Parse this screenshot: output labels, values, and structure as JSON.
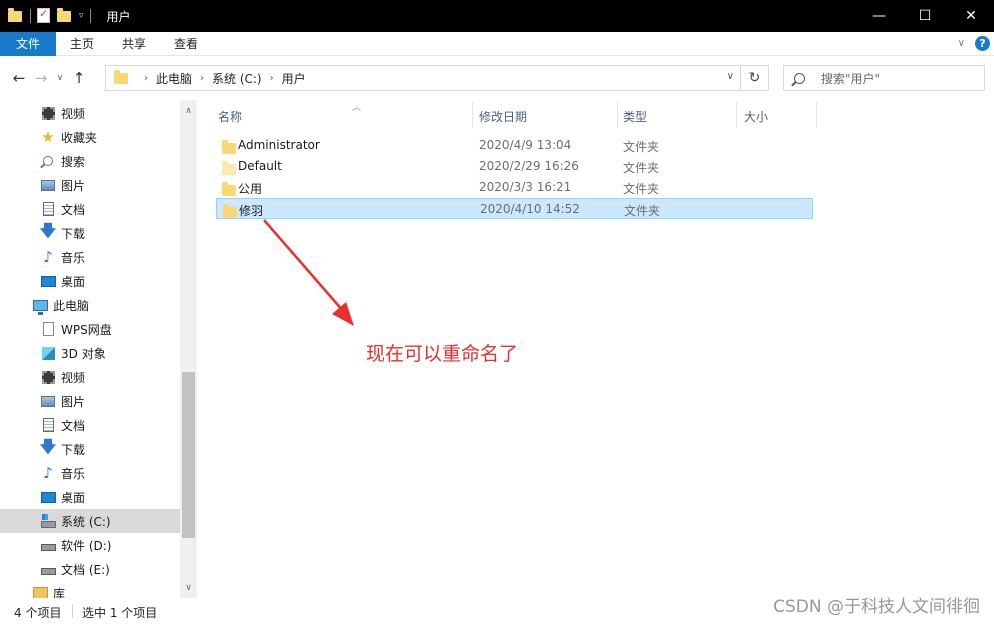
{
  "window": {
    "title": "用户",
    "minimize_icon": "minimize-icon",
    "maximize_icon": "maximize-icon",
    "close_icon": "close-icon"
  },
  "ribbon": {
    "file_tab": "文件",
    "tabs": [
      "主页",
      "共享",
      "查看"
    ]
  },
  "address": {
    "breadcrumbs": [
      "此电脑",
      "系统 (C:)",
      "用户"
    ],
    "search_placeholder": "搜索\"用户\""
  },
  "sidebar": {
    "items": [
      {
        "label": "视频",
        "icon": "video-icon"
      },
      {
        "label": "收藏夹",
        "icon": "star-icon"
      },
      {
        "label": "搜索",
        "icon": "search-icon"
      },
      {
        "label": "图片",
        "icon": "pictures-icon"
      },
      {
        "label": "文档",
        "icon": "documents-icon"
      },
      {
        "label": "下载",
        "icon": "download-icon"
      },
      {
        "label": "音乐",
        "icon": "music-icon"
      },
      {
        "label": "桌面",
        "icon": "desktop-icon"
      },
      {
        "label": "此电脑",
        "icon": "this-pc-icon"
      },
      {
        "label": "WPS网盘",
        "icon": "wps-drive-icon"
      },
      {
        "label": "3D 对象",
        "icon": "3d-objects-icon"
      },
      {
        "label": "视频",
        "icon": "video-icon"
      },
      {
        "label": "图片",
        "icon": "pictures-icon"
      },
      {
        "label": "文档",
        "icon": "documents-icon"
      },
      {
        "label": "下载",
        "icon": "download-icon"
      },
      {
        "label": "音乐",
        "icon": "music-icon"
      },
      {
        "label": "桌面",
        "icon": "desktop-icon"
      },
      {
        "label": "系统 (C:)",
        "icon": "system-drive-icon",
        "selected": true
      },
      {
        "label": "软件 (D:)",
        "icon": "drive-icon"
      },
      {
        "label": "文档 (E:)",
        "icon": "drive-icon"
      },
      {
        "label": "库",
        "icon": "library-icon"
      }
    ]
  },
  "columns": {
    "name": "名称",
    "modified": "修改日期",
    "type": "类型",
    "size": "大小"
  },
  "files": [
    {
      "name": "Administrator",
      "modified": "2020/4/9 13:04",
      "type": "文件夹"
    },
    {
      "name": "Default",
      "modified": "2020/2/29 16:26",
      "type": "文件夹"
    },
    {
      "name": "公用",
      "modified": "2020/3/3 16:21",
      "type": "文件夹"
    },
    {
      "name": "修羽",
      "modified": "2020/4/10 14:52",
      "type": "文件夹",
      "selected": true
    }
  ],
  "annotation": {
    "text": "现在可以重命名了",
    "color": "#e8302c"
  },
  "status": {
    "item_count": "4 个项目",
    "selection": "选中 1 个项目"
  },
  "watermark": "CSDN @于科技人文间徘徊",
  "colors": {
    "accent": "#1979ca",
    "selection_bg": "#cce8ff",
    "selection_border": "#99d1ff"
  }
}
